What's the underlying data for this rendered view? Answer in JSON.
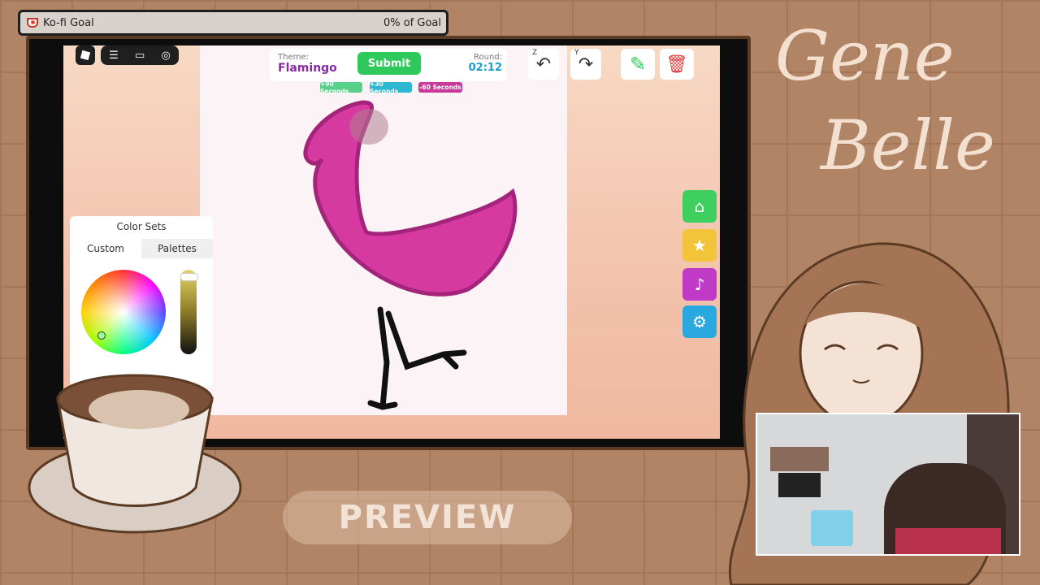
{
  "kofi": {
    "name": "Ko-fi Goal",
    "progress_text": "0% of Goal",
    "progress": 0
  },
  "top_toolbar": {
    "menu_icon": "menu-icon",
    "chat_icon": "chat-icon",
    "headset_icon": "headset-icon"
  },
  "theme_bar": {
    "theme_label": "Theme:",
    "theme_value": "Flamingo",
    "submit_label": "Submit",
    "round_label": "Round:",
    "round_value": "02:12",
    "chips": [
      "+90 Seconds",
      "+30 Seconds",
      "-60 Seconds"
    ]
  },
  "tools": {
    "undo_key": "Z",
    "redo_key": "Y"
  },
  "color_sets": {
    "title": "Color Sets",
    "tabs": [
      "Custom",
      "Palettes"
    ],
    "active_tab": 0
  },
  "overlay": {
    "preview": "PREVIEW",
    "brand_line1": "Gene",
    "brand_line2": "Belle"
  },
  "colors": {
    "submit": "#2ec95a",
    "theme": "#8a2aa8",
    "round": "#1aa0c8",
    "flamingo": "#d63aa0"
  }
}
